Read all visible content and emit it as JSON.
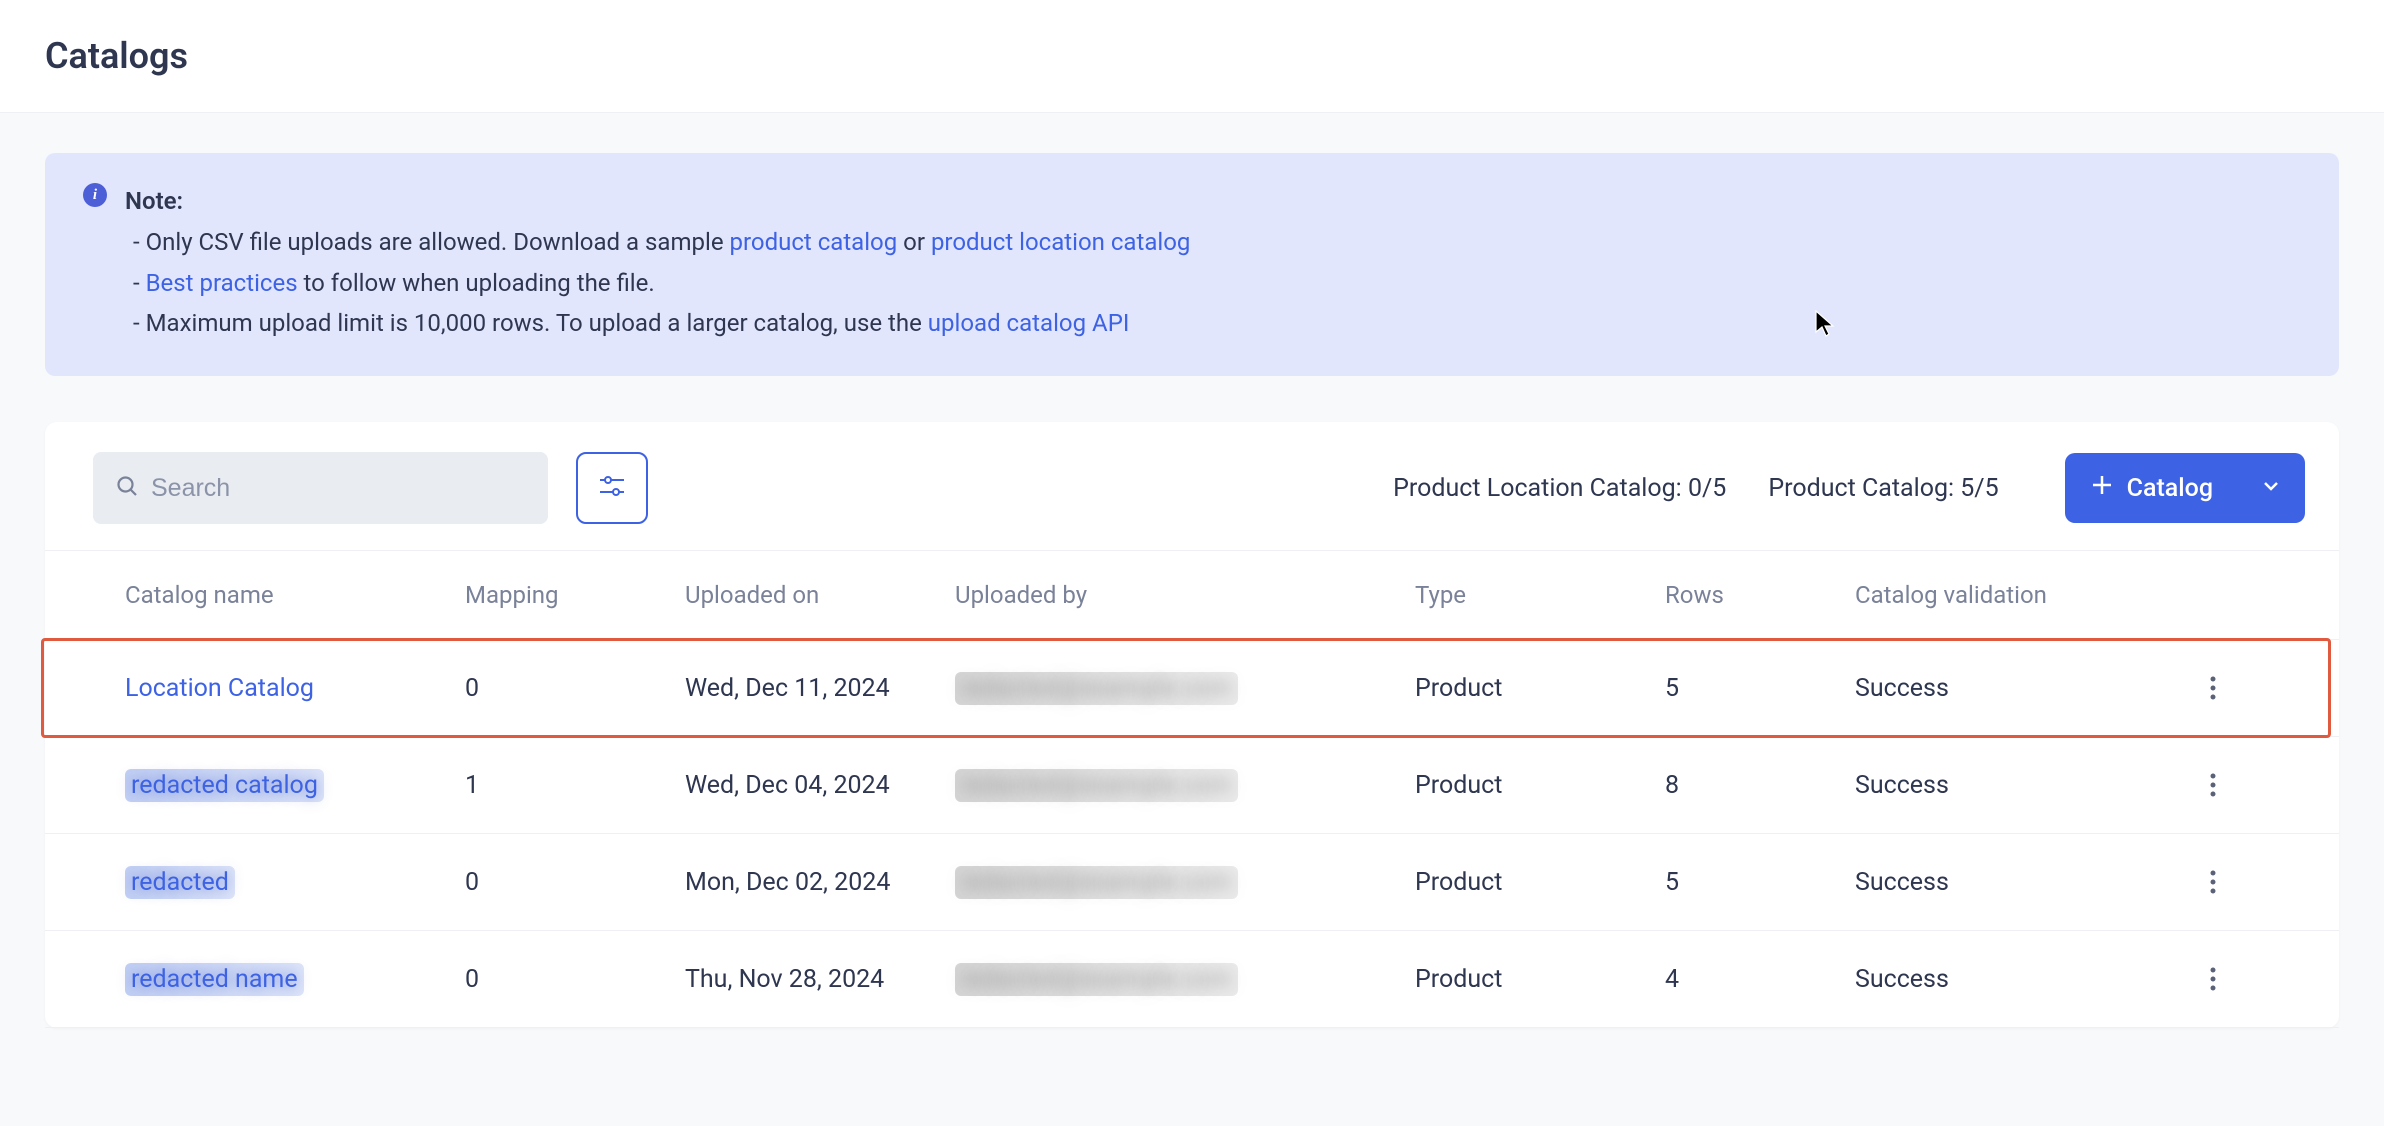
{
  "page": {
    "title": "Catalogs"
  },
  "note": {
    "label": "Note:",
    "line1_prefix": "- Only CSV file uploads are allowed. Download a sample ",
    "link1": "product catalog",
    "line1_mid": " or ",
    "link2": "product location catalog",
    "line2_prefix": "- ",
    "link3": "Best practices",
    "line2_suffix": " to follow when uploading the file.",
    "line3_prefix": "- Maximum upload limit is 10,000 rows. To upload a larger catalog, use the ",
    "link4": "upload catalog API"
  },
  "toolbar": {
    "search_placeholder": "Search",
    "loc_counter_label": "Product Location Catalog: ",
    "loc_counter_value": "0/5",
    "prod_counter_label": "Product Catalog: ",
    "prod_counter_value": "5/5",
    "add_button_label": "Catalog"
  },
  "table": {
    "headers": {
      "name": "Catalog name",
      "mapping": "Mapping",
      "uploaded_on": "Uploaded on",
      "uploaded_by": "Uploaded by",
      "type": "Type",
      "rows": "Rows",
      "validation": "Catalog validation"
    },
    "rows": [
      {
        "name": "Location Catalog",
        "name_blurred": false,
        "mapping": "0",
        "uploaded_on": "Wed, Dec 11, 2024",
        "uploaded_by_blurred": true,
        "type": "Product",
        "rows": "5",
        "validation": "Success",
        "highlighted": true
      },
      {
        "name": "redacted catalog",
        "name_blurred": true,
        "mapping": "1",
        "uploaded_on": "Wed, Dec 04, 2024",
        "uploaded_by_blurred": true,
        "type": "Product",
        "rows": "8",
        "validation": "Success",
        "highlighted": false
      },
      {
        "name": "redacted",
        "name_blurred": true,
        "mapping": "0",
        "uploaded_on": "Mon, Dec 02, 2024",
        "uploaded_by_blurred": true,
        "type": "Product",
        "rows": "5",
        "validation": "Success",
        "highlighted": false
      },
      {
        "name": "redacted name",
        "name_blurred": true,
        "mapping": "0",
        "uploaded_on": "Thu, Nov 28, 2024",
        "uploaded_by_blurred": true,
        "type": "Product",
        "rows": "4",
        "validation": "Success",
        "highlighted": false
      }
    ]
  }
}
